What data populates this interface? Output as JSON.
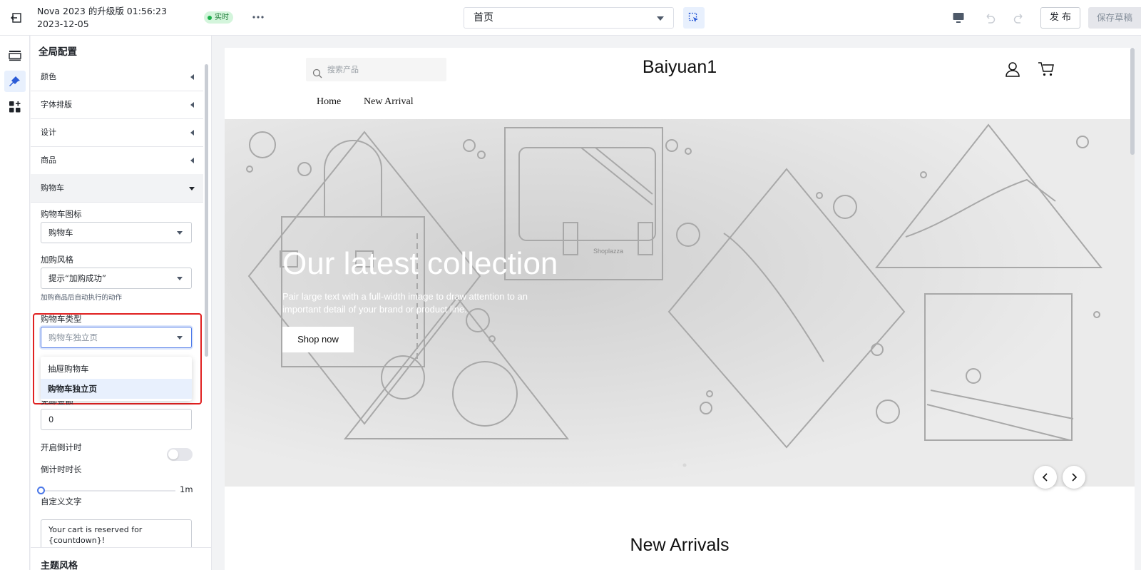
{
  "topbar": {
    "title": "Nova 2023 的升级版 01:56:23 2023-12-05",
    "status_badge": "实时",
    "page_select": "首页",
    "publish_label": "发 布",
    "save_draft_label": "保存草稿"
  },
  "panel": {
    "title": "全局配置",
    "sections": [
      {
        "label": "颜色",
        "open": false
      },
      {
        "label": "字体排版",
        "open": false
      },
      {
        "label": "设计",
        "open": false
      },
      {
        "label": "商品",
        "open": false
      },
      {
        "label": "购物车",
        "open": true
      }
    ],
    "cart_icon": {
      "label": "购物车图标",
      "value": "购物车"
    },
    "add_style": {
      "label": "加购风格",
      "value": "提示“加购成功”",
      "help": "加购商品后自动执行的动作"
    },
    "cart_type": {
      "label": "购物车类型",
      "value": "购物车独立页",
      "options": [
        "抽屉购物车",
        "购物车独立页"
      ],
      "selected_index": 1
    },
    "free_shipping": {
      "label": "免邮金额",
      "value": "0"
    },
    "countdown_toggle": {
      "label": "开启倒计时",
      "on": false
    },
    "countdown_duration": {
      "label": "倒计时时长",
      "value_text": "1m",
      "level": 0
    },
    "custom_text": {
      "label": "自定义文字",
      "value": "Your cart is reserved for\n{countdown}!"
    },
    "theme_style": "主题风格"
  },
  "store": {
    "search_placeholder": "搜索产品",
    "brand": "Baiyuan1",
    "nav": [
      "Home",
      "New Arrival"
    ],
    "hero_title": "Our latest collection",
    "hero_subtitle": "Pair large text with a full-width image to draw attention to an important detail of your brand or product line.",
    "shop_now": "Shop now",
    "hero_watermark": "Shoplazza",
    "section_title": "New Arrivals"
  },
  "colors": {
    "accent": "#4a77e8",
    "highlight_border": "#e02020",
    "live_badge": "#d4f5dc"
  }
}
